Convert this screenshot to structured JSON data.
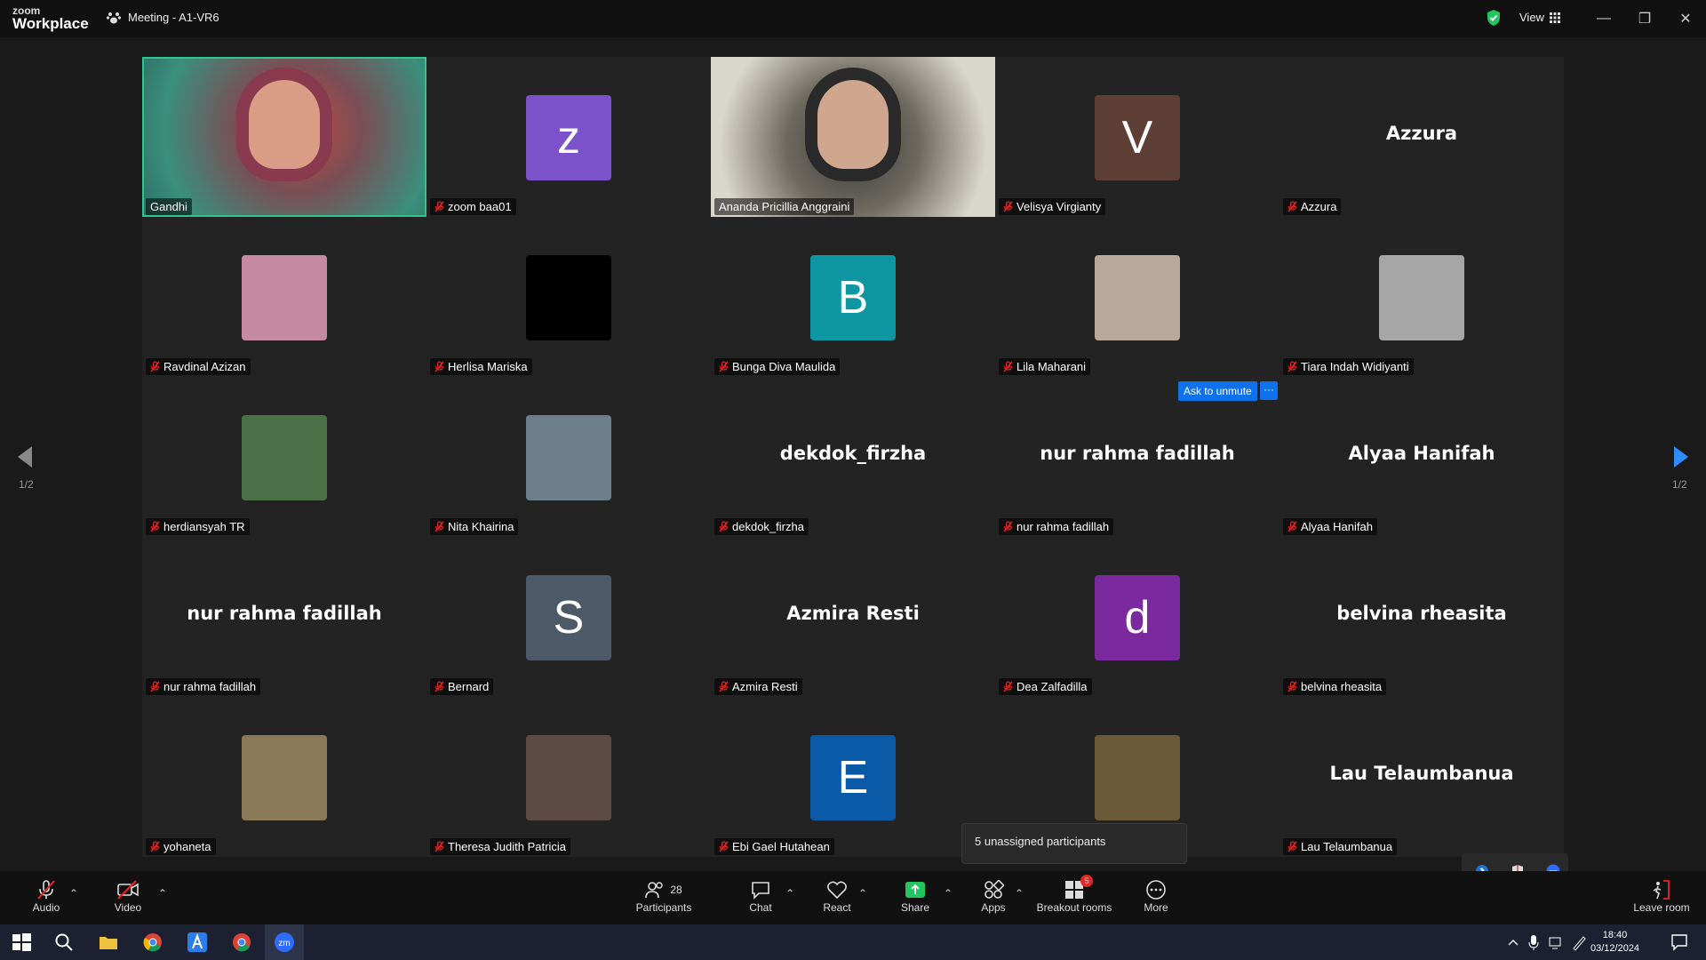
{
  "titlebar": {
    "logo_top": "zoom",
    "logo_bottom": "Workplace",
    "meeting_title": "Meeting - A1-VR6",
    "view_label": "View"
  },
  "gallery": {
    "page_left": "1/2",
    "page_right": "1/2",
    "tiles": [
      {
        "name": "Gandhi",
        "type": "video",
        "muted": false,
        "active": true
      },
      {
        "name": "zoom baa01",
        "type": "letter",
        "letter": "z",
        "color": "#7b52c9",
        "muted": true
      },
      {
        "name": "Ananda Pricillia Anggraini",
        "type": "video",
        "muted": false
      },
      {
        "name": "Velisya Virgianty",
        "type": "letter",
        "letter": "V",
        "color": "#5d3f36",
        "muted": true
      },
      {
        "name": "Azzura",
        "type": "bigname",
        "bigname": "Azzura",
        "muted": true
      },
      {
        "name": "Ravdinal Azizan",
        "type": "photo",
        "color": "#c58aa0",
        "muted": true
      },
      {
        "name": "Herlisa Mariska",
        "type": "photo",
        "color": "#000000",
        "muted": true
      },
      {
        "name": "Bunga Diva Maulida",
        "type": "letter",
        "letter": "B",
        "color": "#0e97a3",
        "muted": true
      },
      {
        "name": "Lila Maharani",
        "type": "photo",
        "color": "#b9a89a",
        "muted": true
      },
      {
        "name": "Tiara Indah Widiyanti",
        "type": "photo",
        "color": "#a6a6a6",
        "muted": true
      },
      {
        "name": "herdiansyah TR",
        "type": "photo",
        "color": "#4b6f47",
        "muted": true
      },
      {
        "name": "Nita Khairina",
        "type": "photo",
        "color": "#6d7f8a",
        "muted": true
      },
      {
        "name": "dekdok_firzha",
        "type": "bigname",
        "bigname": "dekdok_firzha",
        "muted": true
      },
      {
        "name": "nur rahma fadillah",
        "type": "bigname",
        "bigname": "nur rahma fadillah",
        "muted": true
      },
      {
        "name": "Alyaa Hanifah",
        "type": "bigname",
        "bigname": "Alyaa Hanifah",
        "muted": true
      },
      {
        "name": "nur rahma fadillah",
        "type": "bigname",
        "bigname": "nur rahma fadillah",
        "muted": true
      },
      {
        "name": "Bernard",
        "type": "letter",
        "letter": "S",
        "color": "#4b5a66",
        "muted": true
      },
      {
        "name": "Azmira Resti",
        "type": "bigname",
        "bigname": "Azmira Resti",
        "muted": true
      },
      {
        "name": "Dea Zalfadilla",
        "type": "letter",
        "letter": "d",
        "color": "#7a2a9e",
        "muted": true
      },
      {
        "name": "belvina rheasita",
        "type": "bigname",
        "bigname": "belvina rheasita",
        "muted": true
      },
      {
        "name": "yohaneta",
        "type": "photo",
        "color": "#8a7a5a",
        "muted": true
      },
      {
        "name": "Theresa Judith Patricia",
        "type": "photo",
        "color": "#5e4a44",
        "muted": true
      },
      {
        "name": "Ebi Gael Hutahean",
        "type": "letter",
        "letter": "E",
        "color": "#0b5aa8",
        "muted": true
      },
      {
        "name": "",
        "type": "photo",
        "color": "#6b5a3a",
        "muted": false
      },
      {
        "name": "Lau Telaumbanua",
        "type": "bigname",
        "bigname": "Lau Telaumbanua",
        "muted": true
      }
    ],
    "ask_to_unmute": "Ask to unmute",
    "more_dots": "···",
    "unassigned": "5 unassigned participants"
  },
  "toolbar": {
    "audio": "Audio",
    "video": "Video",
    "participants": "Participants",
    "participants_count": "28",
    "chat": "Chat",
    "react": "React",
    "share": "Share",
    "apps": "Apps",
    "breakout": "Breakout rooms",
    "breakout_badge": "5",
    "more": "More",
    "leave": "Leave room"
  },
  "taskbar": {
    "time": "18:40",
    "date": "03/12/2024"
  },
  "colors": {
    "accent_blue": "#0e72ed",
    "share_green": "#22c55e",
    "active_speaker": "#31c48d"
  }
}
